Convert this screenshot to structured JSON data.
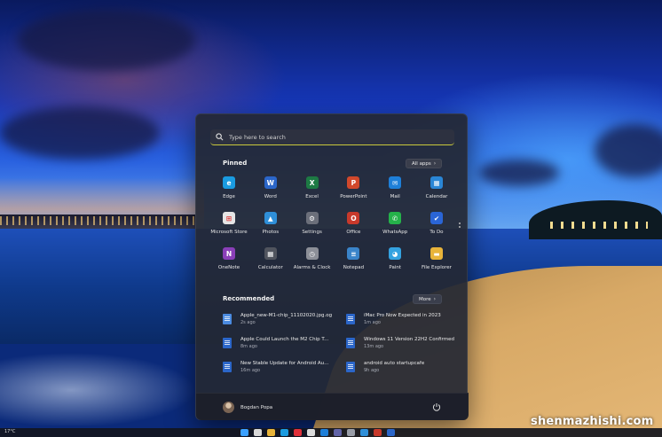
{
  "search": {
    "placeholder": "Type here to search"
  },
  "pinned": {
    "title": "Pinned",
    "all_apps_label": "All apps",
    "apps": [
      {
        "label": "Edge",
        "icon": "edge-icon",
        "color": "#1a9be0",
        "glyph": "e"
      },
      {
        "label": "Word",
        "icon": "word-icon",
        "color": "#2b66c9",
        "glyph": "W"
      },
      {
        "label": "Excel",
        "icon": "excel-icon",
        "color": "#1d7a44",
        "glyph": "X"
      },
      {
        "label": "PowerPoint",
        "icon": "powerpoint-icon",
        "color": "#d1482b",
        "glyph": "P"
      },
      {
        "label": "Mail",
        "icon": "mail-icon",
        "color": "#1e7fd8",
        "glyph": "✉"
      },
      {
        "label": "Calendar",
        "icon": "calendar-icon",
        "color": "#2a86d6",
        "glyph": "▦"
      },
      {
        "label": "Microsoft Store",
        "icon": "store-icon",
        "color": "#e5e5e5",
        "glyph": "⊞"
      },
      {
        "label": "Photos",
        "icon": "photos-icon",
        "color": "#2f8fd8",
        "glyph": "▲"
      },
      {
        "label": "Settings",
        "icon": "settings-icon",
        "color": "#6b6f7a",
        "glyph": "⚙"
      },
      {
        "label": "Office",
        "icon": "office-icon",
        "color": "#c8392b",
        "glyph": "O"
      },
      {
        "label": "WhatsApp",
        "icon": "whatsapp-icon",
        "color": "#25b24a",
        "glyph": "✆"
      },
      {
        "label": "To Do",
        "icon": "todo-icon",
        "color": "#2a65d6",
        "glyph": "✔"
      },
      {
        "label": "OneNote",
        "icon": "onenote-icon",
        "color": "#8a3fb8",
        "glyph": "N"
      },
      {
        "label": "Calculator",
        "icon": "calculator-icon",
        "color": "#50545e",
        "glyph": "▦"
      },
      {
        "label": "Alarms & Clock",
        "icon": "clock-icon",
        "color": "#8c8f98",
        "glyph": "◷"
      },
      {
        "label": "Notepad",
        "icon": "notepad-icon",
        "color": "#3a84c9",
        "glyph": "≡"
      },
      {
        "label": "Paint",
        "icon": "paint-icon",
        "color": "#34a2e0",
        "glyph": "◕"
      },
      {
        "label": "File Explorer",
        "icon": "folder-icon",
        "color": "#e8b43a",
        "glyph": "▬"
      }
    ]
  },
  "recommended": {
    "title": "Recommended",
    "more_label": "More",
    "items": [
      {
        "name": "Apple_new-M1-chip_11102020.jpg.og",
        "time": "2s ago",
        "icon": "image-file-icon",
        "color": "#4b8be0"
      },
      {
        "name": "iMac Pro Now Expected in 2023",
        "time": "1m ago",
        "icon": "word-doc-icon",
        "color": "#2b66c9"
      },
      {
        "name": "Apple Could Launch the M2 Chip T...",
        "time": "8m ago",
        "icon": "word-doc-icon",
        "color": "#2b66c9"
      },
      {
        "name": "Windows 11 Version 22H2 Confirmed",
        "time": "13m ago",
        "icon": "word-doc-icon",
        "color": "#2b66c9"
      },
      {
        "name": "New Stable Update for Android Au...",
        "time": "16m ago",
        "icon": "word-doc-icon",
        "color": "#2b66c9"
      },
      {
        "name": "android auto startupcafe",
        "time": "9h ago",
        "icon": "word-doc-icon",
        "color": "#2b66c9"
      }
    ]
  },
  "user": {
    "name": "Bogdan Popa"
  },
  "taskbar": {
    "weather": "17°C",
    "icons": [
      {
        "icon": "start-icon",
        "color": "#3aa0ff"
      },
      {
        "icon": "search-icon",
        "color": "#d8d8d8"
      },
      {
        "icon": "folder-icon",
        "color": "#e8b43a"
      },
      {
        "icon": "edge-icon",
        "color": "#1a9be0"
      },
      {
        "icon": "opera-icon",
        "color": "#e0303a"
      },
      {
        "icon": "store-icon",
        "color": "#dcdcdc"
      },
      {
        "icon": "mail-icon",
        "color": "#1e7fd8"
      },
      {
        "icon": "teams-icon",
        "color": "#6264a7"
      },
      {
        "icon": "settings-icon",
        "color": "#9a9ea8"
      },
      {
        "icon": "photos-icon",
        "color": "#2f8fd8"
      },
      {
        "icon": "office-icon",
        "color": "#c8392b"
      },
      {
        "icon": "word-icon",
        "color": "#2b66c9"
      }
    ]
  },
  "watermark": "shenmazhishi.com"
}
